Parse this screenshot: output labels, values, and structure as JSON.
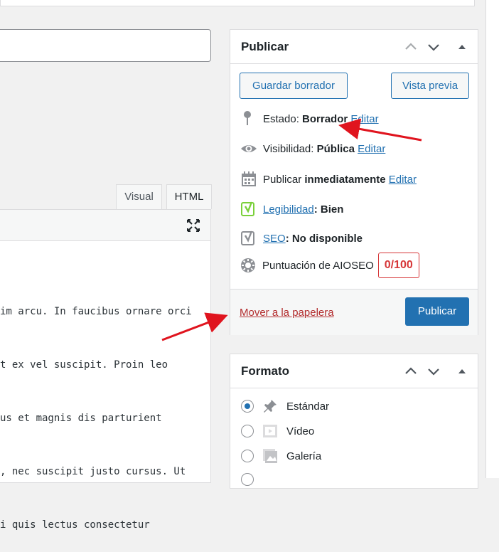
{
  "editor": {
    "tabs": [
      "Visual",
      "HTML"
    ],
    "code_lines": [
      "im arcu. In faucibus ornare orci",
      "t ex vel suscipit. Proin leo",
      "us et magnis dis parturient",
      ", nec suscipit justo cursus. Ut",
      "i quis lectus consectetur"
    ]
  },
  "publish": {
    "title": "Publicar",
    "save_draft": "Guardar borrador",
    "preview": "Vista previa",
    "status_label": "Estado:",
    "status_value": "Borrador",
    "visibility_label": "Visibilidad:",
    "visibility_value": "Pública",
    "schedule_label": "Publicar",
    "schedule_value": "inmediatamente",
    "edit": "Editar",
    "readability_link": "Legibilidad",
    "readability_value": ": Bien",
    "seo_link": "SEO",
    "seo_value": ": No disponible",
    "aioseo_label": "Puntuación de AIOSEO",
    "aioseo_score": "0/100",
    "trash": "Mover a la papelera",
    "publish_button": "Publicar"
  },
  "format": {
    "title": "Formato",
    "options": [
      "Estándar",
      "Vídeo",
      "Galería"
    ]
  },
  "colors": {
    "accent": "#2271b1",
    "danger": "#d63638",
    "yoast_good": "#7ad03a",
    "arrow": "#e0141e"
  },
  "icons": [
    "chevron-up-icon",
    "chevron-down-icon",
    "triangle-toggle-icon",
    "fullscreen-icon",
    "pin-icon",
    "eye-icon",
    "calendar-icon",
    "yoast-icon",
    "gear-icon",
    "pushpin-icon",
    "video-icon",
    "gallery-icon"
  ]
}
